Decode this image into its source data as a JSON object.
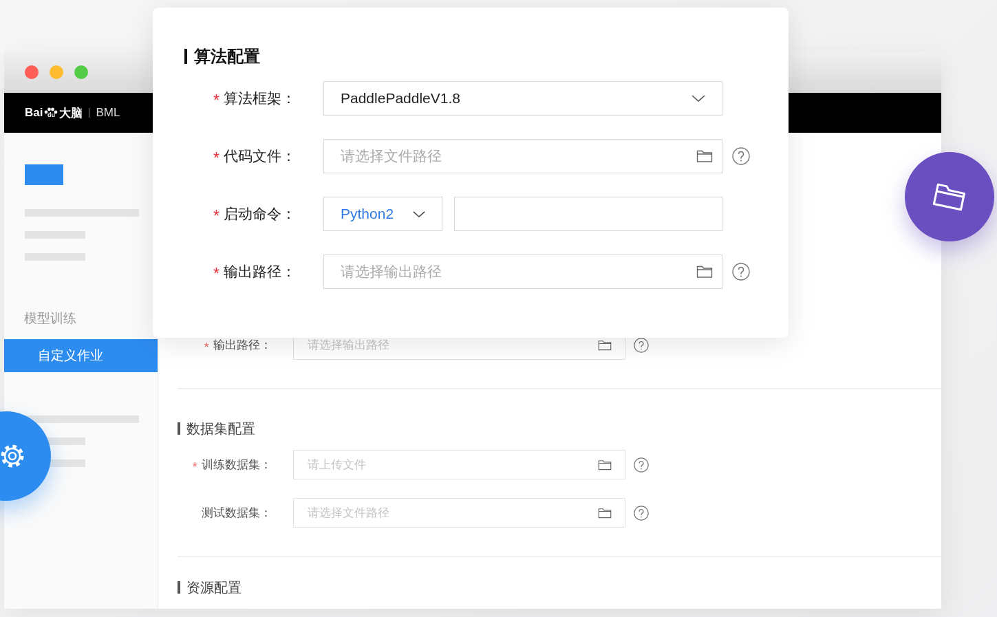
{
  "window": {
    "brand": {
      "name_start": "Bai",
      "paw_text": "du",
      "name_end": "大脑",
      "product": "BML"
    }
  },
  "sidebar": {
    "group_label": "模型训练",
    "items": [
      {
        "label": "自定义作业",
        "selected": true
      }
    ]
  },
  "dialog": {
    "title": "算法配置",
    "fields": [
      {
        "kind": "select",
        "required_mark": "*",
        "label": "算法框架：",
        "value": "PaddlePaddleV1.8"
      },
      {
        "kind": "file",
        "required_mark": "*",
        "label": "代码文件：",
        "placeholder": "请选择文件路径",
        "help": true
      },
      {
        "kind": "command",
        "required_mark": "*",
        "label": "启动命令：",
        "interpreter": "Python2"
      },
      {
        "kind": "file",
        "required_mark": "*",
        "label": "输出路径：",
        "placeholder": "请选择输出路径",
        "help": true
      }
    ]
  },
  "form": {
    "items": [
      {
        "kind": "file",
        "required_mark": "*",
        "label": "输出路径：",
        "placeholder": "请选择输出路径",
        "help": true
      },
      {
        "kind": "section",
        "title": "数据集配置"
      },
      {
        "kind": "file",
        "required_mark": "*",
        "label": "训练数据集：",
        "placeholder": "请上传文件",
        "help": true
      },
      {
        "kind": "file",
        "label": "测试数据集：",
        "placeholder": "请选择文件路径",
        "help": true
      },
      {
        "kind": "section",
        "title": "资源配置"
      }
    ]
  }
}
